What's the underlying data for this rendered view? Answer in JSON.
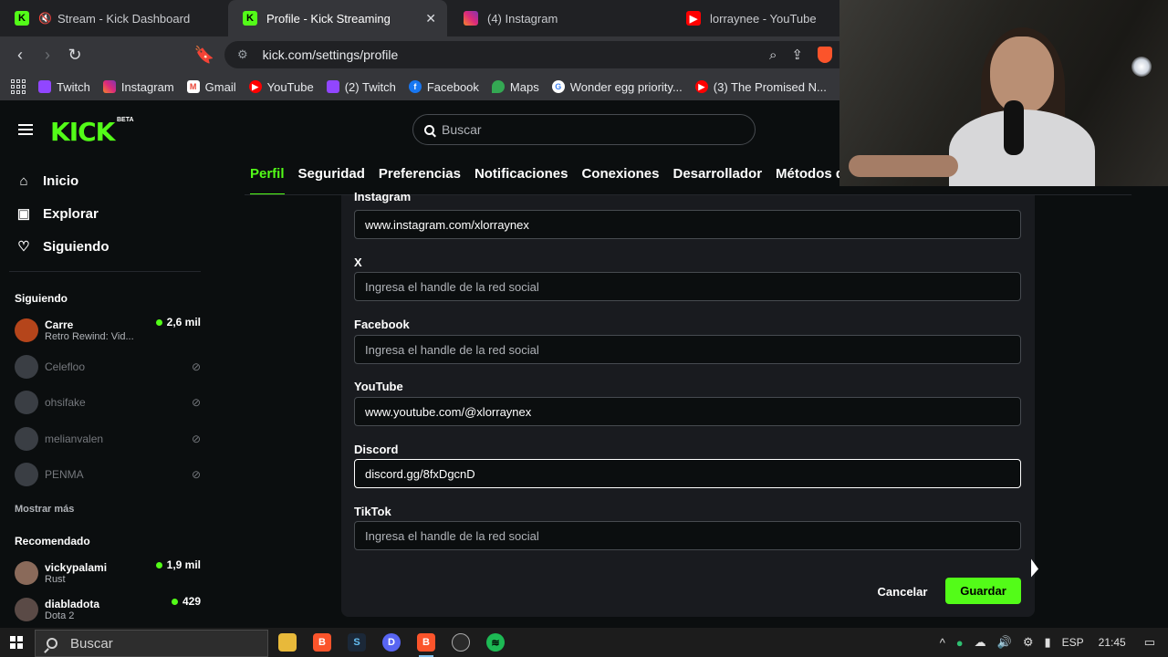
{
  "browser": {
    "tabs": [
      {
        "title": "Stream - Kick Dashboard",
        "favicon": "kick-icon",
        "muted": true,
        "active": false
      },
      {
        "title": "Profile - Kick Streaming",
        "favicon": "kick-icon",
        "active": true
      },
      {
        "title": "(4) Instagram",
        "favicon": "instagram-icon",
        "active": false
      },
      {
        "title": "lorraynee - YouTube",
        "favicon": "youtube-icon",
        "active": false
      }
    ],
    "url": "kick.com/settings/profile",
    "brave_badge": "5",
    "bookmarks": [
      {
        "label": "Twitch",
        "icon": "twitch-icon"
      },
      {
        "label": "Instagram",
        "icon": "instagram-icon"
      },
      {
        "label": "Gmail",
        "icon": "gmail-icon"
      },
      {
        "label": "YouTube",
        "icon": "youtube-icon"
      },
      {
        "label": "(2) Twitch",
        "icon": "twitch-icon"
      },
      {
        "label": "Facebook",
        "icon": "facebook-icon"
      },
      {
        "label": "Maps",
        "icon": "maps-icon"
      },
      {
        "label": "Wonder egg priority...",
        "icon": "google-icon"
      },
      {
        "label": "(3) The Promised N...",
        "icon": "youtube-icon"
      }
    ]
  },
  "kick": {
    "logo": "KICK",
    "logo_badge": "BETA",
    "search_placeholder": "Buscar",
    "nav": [
      {
        "label": "Inicio",
        "icon": "home-icon"
      },
      {
        "label": "Explorar",
        "icon": "explore-icon"
      },
      {
        "label": "Siguiendo",
        "icon": "heart-icon"
      }
    ],
    "following_title": "Siguiendo",
    "following": [
      {
        "name": "Carre",
        "subtitle": "Retro Rewind: Vid...",
        "viewers": "2,6 mil",
        "live": true
      },
      {
        "name": "Celefloo",
        "live": false
      },
      {
        "name": "ohsifake",
        "live": false
      },
      {
        "name": "melianvalen",
        "live": false
      },
      {
        "name": "PENMA",
        "live": false
      }
    ],
    "show_more": "Mostrar más",
    "recommended_title": "Recomendado",
    "recommended": [
      {
        "name": "vickypalami",
        "subtitle": "Rust",
        "viewers": "1,9 mil"
      },
      {
        "name": "diabladota",
        "subtitle": "Dota 2",
        "viewers": "429"
      }
    ],
    "settings_tabs": [
      "Perfil",
      "Seguridad",
      "Preferencias",
      "Notificaciones",
      "Conexiones",
      "Desarrollador",
      "Métodos de"
    ],
    "fields": {
      "instagram_label": "Instagram",
      "instagram_value": "www.instagram.com/xlorraynex",
      "x_label": "X",
      "x_placeholder": "Ingresa el handle de la red social",
      "facebook_label": "Facebook",
      "facebook_placeholder": "Ingresa el handle de la red social",
      "youtube_label": "YouTube",
      "youtube_value": "www.youtube.com/@xlorraynex",
      "discord_label": "Discord",
      "discord_value": "discord.gg/8fxDgcnD",
      "tiktok_label": "TikTok",
      "tiktok_placeholder": "Ingresa el handle de la red social"
    },
    "cancel_label": "Cancelar",
    "save_label": "Guardar"
  },
  "taskbar": {
    "search_placeholder": "Buscar",
    "language": "ESP",
    "time": "21:45"
  },
  "colors": {
    "accent": "#53fc18",
    "background": "#0b0e0f",
    "panel": "#191b1f"
  }
}
